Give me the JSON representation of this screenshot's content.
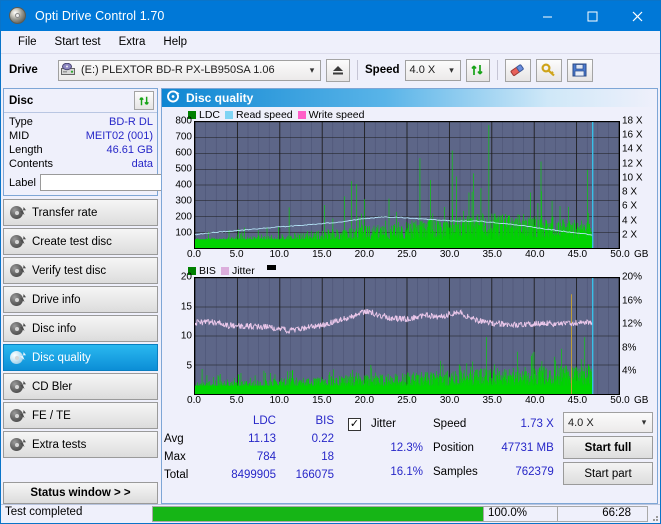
{
  "window": {
    "title": "Opti Drive Control 1.70",
    "icon": "disc-icon",
    "minimize": "minimize-icon",
    "maximize": "maximize-icon",
    "close": "close-icon"
  },
  "menu": [
    {
      "label": "File"
    },
    {
      "label": "Start test"
    },
    {
      "label": "Extra"
    },
    {
      "label": "Help"
    }
  ],
  "toolbar": {
    "drive_label": "Drive",
    "drive_value": "(E:)  PLEXTOR BD-R  PX-LB950SA 1.06",
    "eject_icon": "eject-icon",
    "speed_label": "Speed",
    "speed_value": "4.0 X",
    "refresh_icon": "refresh-icon",
    "eraser_icon": "eraser-icon",
    "key_icon": "key-icon",
    "save_icon": "save-icon"
  },
  "disc_panel": {
    "title": "Disc",
    "refresh_icon": "refresh-icon",
    "rows": [
      {
        "key": "Type",
        "value": "BD-R DL"
      },
      {
        "key": "MID",
        "value": "MEIT02 (001)"
      },
      {
        "key": "Length",
        "value": "46.61 GB"
      },
      {
        "key": "Contents",
        "value": "data"
      }
    ],
    "label_key": "Label",
    "label_value": "",
    "label_placeholder": "",
    "disc_button_icon": "disc-icon"
  },
  "nav": {
    "items": [
      {
        "label": "Transfer rate",
        "icon": "disc-icon",
        "active": false
      },
      {
        "label": "Create test disc",
        "icon": "disc-icon",
        "active": false
      },
      {
        "label": "Verify test disc",
        "icon": "disc-icon",
        "active": false
      },
      {
        "label": "Drive info",
        "icon": "disc-icon",
        "active": false
      },
      {
        "label": "Disc info",
        "icon": "disc-icon",
        "active": false
      },
      {
        "label": "Disc quality",
        "icon": "disc-icon",
        "active": true
      },
      {
        "label": "CD Bler",
        "icon": "disc-icon",
        "active": false
      },
      {
        "label": "FE / TE",
        "icon": "disc-icon",
        "active": false
      },
      {
        "label": "Extra tests",
        "icon": "disc-icon",
        "active": false
      }
    ],
    "status_window": "Status window > >"
  },
  "main": {
    "title": "Disc quality",
    "icon": "disc-icon"
  },
  "chart_data": [
    {
      "type": "area",
      "name": "top-chart-ldc",
      "title": "",
      "xlabel": "GB",
      "ylabel": "",
      "xlim": [
        0,
        50
      ],
      "ylim": [
        0,
        800
      ],
      "y2lim": [
        0,
        18
      ],
      "xticks": [
        "0.0",
        "5.0",
        "10.0",
        "15.0",
        "20.0",
        "25.0",
        "30.0",
        "35.0",
        "40.0",
        "45.0",
        "50.0"
      ],
      "yticks": [
        "100",
        "200",
        "300",
        "400",
        "500",
        "600",
        "700",
        "800"
      ],
      "y2ticks": [
        "2 X",
        "4 X",
        "6 X",
        "8 X",
        "10 X",
        "12 X",
        "14 X",
        "16 X",
        "18 X"
      ],
      "xunit": "GB",
      "grid": true,
      "legend_position": "top-left",
      "legend": [
        {
          "label": "LDC",
          "color": "#00a000"
        },
        {
          "label": "Read speed",
          "color": "#7fd4f4"
        },
        {
          "label": "Write speed",
          "color": "#ff66cc"
        }
      ],
      "series": [
        {
          "name": "LDC",
          "type": "impulse",
          "color": "#00d000",
          "note": "dense green error spikes from 0 to 46.9 GB; baseline ~40-120, rising with radius",
          "x_end": 46.9,
          "baseline": [
            60,
            60,
            70,
            70,
            80,
            80,
            90,
            100,
            110,
            120,
            130,
            140,
            150,
            160,
            170,
            180,
            190,
            200,
            200,
            200,
            190,
            180,
            170,
            160
          ]
        },
        {
          "name": "Read speed",
          "type": "line",
          "color": "#a8e4fb",
          "note": "rises from ~2X at 0GB to ~4.5X near 21GB then declines to ~1.8X at 47GB",
          "points": [
            [
              0,
              1.9
            ],
            [
              2,
              2.2
            ],
            [
              5,
              2.5
            ],
            [
              8,
              2.8
            ],
            [
              11,
              3.1
            ],
            [
              14,
              3.4
            ],
            [
              17,
              3.7
            ],
            [
              20,
              4.2
            ],
            [
              22,
              4.4
            ],
            [
              24,
              4.4
            ],
            [
              26,
              4.2
            ],
            [
              30,
              3.9
            ],
            [
              34,
              3.8
            ],
            [
              38,
              3.3
            ],
            [
              42,
              2.6
            ],
            [
              46,
              2.0
            ],
            [
              46.9,
              1.8
            ]
          ]
        }
      ],
      "cursor_x": 46.9,
      "cursor_color": "#35c8f0"
    },
    {
      "type": "area",
      "name": "bottom-chart-bis-jitter",
      "title": "",
      "xlabel": "GB",
      "xlim": [
        0,
        50
      ],
      "ylim": [
        0,
        20
      ],
      "y2lim": [
        0,
        20
      ],
      "xticks": [
        "0.0",
        "5.0",
        "10.0",
        "15.0",
        "20.0",
        "25.0",
        "30.0",
        "35.0",
        "40.0",
        "45.0",
        "50.0"
      ],
      "yticks": [
        "5",
        "10",
        "15",
        "20"
      ],
      "y2ticks": [
        "4%",
        "8%",
        "12%",
        "16%",
        "20%"
      ],
      "xunit": "GB",
      "grid": true,
      "legend_position": "top-left",
      "legend": [
        {
          "label": "BIS",
          "color": "#00a000"
        },
        {
          "label": "Jitter",
          "color": "#e0b8e0"
        },
        {
          "label": "",
          "color": "#000000"
        }
      ],
      "series": [
        {
          "name": "BIS",
          "type": "impulse",
          "color": "#00d000",
          "note": "green spikes, baseline ~1.5 rising to ~4.5, peaks to 10",
          "x_end": 46.9
        },
        {
          "name": "Jitter",
          "type": "line",
          "color": "#e6bfe6",
          "note": "noisy band around 11-15%, dips to 10.8 near 11GB, peak ~15 near 20GB and 31GB",
          "points": [
            [
              0,
              12.3
            ],
            [
              2,
              12.4
            ],
            [
              4,
              11.8
            ],
            [
              6,
              11.7
            ],
            [
              8,
              11.6
            ],
            [
              10,
              11.4
            ],
            [
              11,
              10.9
            ],
            [
              13,
              11.4
            ],
            [
              15,
              11.8
            ],
            [
              17,
              12.7
            ],
            [
              19,
              13.5
            ],
            [
              20,
              14.2
            ],
            [
              21,
              14.0
            ],
            [
              23,
              13.1
            ],
            [
              25,
              12.9
            ],
            [
              27,
              13.6
            ],
            [
              29,
              13.3
            ],
            [
              31,
              14.2
            ],
            [
              33,
              12.8
            ],
            [
              35,
              12.2
            ],
            [
              37,
              12.0
            ],
            [
              39,
              11.9
            ],
            [
              41,
              12.3
            ],
            [
              43,
              12.0
            ],
            [
              45,
              12.3
            ],
            [
              46.9,
              12.4
            ]
          ]
        }
      ],
      "cursor_x": 46.9,
      "cursor_color": "#35c8f0",
      "marker_x": 44.4,
      "marker_color": "#c8a030"
    }
  ],
  "stats": {
    "headers": {
      "ldc": "LDC",
      "bis": "BIS",
      "jitter": "Jitter"
    },
    "rows": [
      {
        "label": "Avg",
        "ldc": "11.13",
        "bis": "0.22",
        "jitter": "12.3%"
      },
      {
        "label": "Max",
        "ldc": "784",
        "bis": "18",
        "jitter": "16.1%"
      },
      {
        "label": "Total",
        "ldc": "8499905",
        "bis": "166075",
        "jitter": ""
      }
    ],
    "jitter_checked": true,
    "jitter_check_glyph": "check-icon",
    "speed_label": "Speed",
    "speed_value": "1.73 X",
    "position_label": "Position",
    "position_value": "47731 MB",
    "samples_label": "Samples",
    "samples_value": "762379",
    "speed_select": "4.0 X",
    "start_full": "Start full",
    "start_part": "Start part"
  },
  "statusbar": {
    "text": "Test completed",
    "progress_percent": 100.0,
    "progress_label": "100.0%",
    "elapsed": "66:28"
  },
  "colors": {
    "accent": "#0078d7",
    "plot_bg": "#5d6688",
    "ldc_green": "#00d000",
    "read_speed": "#a8e4fb",
    "write_speed": "#ff66cc",
    "jitter_pink": "#e6bfe6",
    "value_blue": "#2727c8",
    "progress_green": "#16b516"
  }
}
